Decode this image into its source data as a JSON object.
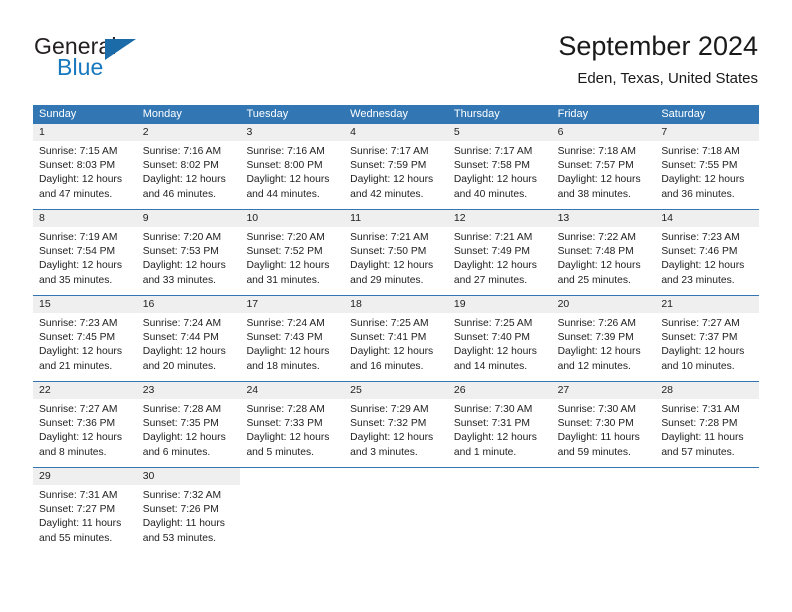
{
  "brand": {
    "name_part1": "General",
    "name_part2": "Blue",
    "triangle_icon": "brand-triangle-icon",
    "accent_color": "#1878be",
    "triangle_color": "#1a6ba8"
  },
  "header": {
    "title": "September 2024",
    "subtitle": "Eden, Texas, United States"
  },
  "theme": {
    "header_blue": "#3277b4",
    "day_number_bg": "#efefef",
    "text_color": "#222222"
  },
  "weekdays": [
    "Sunday",
    "Monday",
    "Tuesday",
    "Wednesday",
    "Thursday",
    "Friday",
    "Saturday"
  ],
  "weeks": [
    [
      {
        "day": "1",
        "sunrise": "Sunrise: 7:15 AM",
        "sunset": "Sunset: 8:03 PM",
        "daylight1": "Daylight: 12 hours",
        "daylight2": "and 47 minutes."
      },
      {
        "day": "2",
        "sunrise": "Sunrise: 7:16 AM",
        "sunset": "Sunset: 8:02 PM",
        "daylight1": "Daylight: 12 hours",
        "daylight2": "and 46 minutes."
      },
      {
        "day": "3",
        "sunrise": "Sunrise: 7:16 AM",
        "sunset": "Sunset: 8:00 PM",
        "daylight1": "Daylight: 12 hours",
        "daylight2": "and 44 minutes."
      },
      {
        "day": "4",
        "sunrise": "Sunrise: 7:17 AM",
        "sunset": "Sunset: 7:59 PM",
        "daylight1": "Daylight: 12 hours",
        "daylight2": "and 42 minutes."
      },
      {
        "day": "5",
        "sunrise": "Sunrise: 7:17 AM",
        "sunset": "Sunset: 7:58 PM",
        "daylight1": "Daylight: 12 hours",
        "daylight2": "and 40 minutes."
      },
      {
        "day": "6",
        "sunrise": "Sunrise: 7:18 AM",
        "sunset": "Sunset: 7:57 PM",
        "daylight1": "Daylight: 12 hours",
        "daylight2": "and 38 minutes."
      },
      {
        "day": "7",
        "sunrise": "Sunrise: 7:18 AM",
        "sunset": "Sunset: 7:55 PM",
        "daylight1": "Daylight: 12 hours",
        "daylight2": "and 36 minutes."
      }
    ],
    [
      {
        "day": "8",
        "sunrise": "Sunrise: 7:19 AM",
        "sunset": "Sunset: 7:54 PM",
        "daylight1": "Daylight: 12 hours",
        "daylight2": "and 35 minutes."
      },
      {
        "day": "9",
        "sunrise": "Sunrise: 7:20 AM",
        "sunset": "Sunset: 7:53 PM",
        "daylight1": "Daylight: 12 hours",
        "daylight2": "and 33 minutes."
      },
      {
        "day": "10",
        "sunrise": "Sunrise: 7:20 AM",
        "sunset": "Sunset: 7:52 PM",
        "daylight1": "Daylight: 12 hours",
        "daylight2": "and 31 minutes."
      },
      {
        "day": "11",
        "sunrise": "Sunrise: 7:21 AM",
        "sunset": "Sunset: 7:50 PM",
        "daylight1": "Daylight: 12 hours",
        "daylight2": "and 29 minutes."
      },
      {
        "day": "12",
        "sunrise": "Sunrise: 7:21 AM",
        "sunset": "Sunset: 7:49 PM",
        "daylight1": "Daylight: 12 hours",
        "daylight2": "and 27 minutes."
      },
      {
        "day": "13",
        "sunrise": "Sunrise: 7:22 AM",
        "sunset": "Sunset: 7:48 PM",
        "daylight1": "Daylight: 12 hours",
        "daylight2": "and 25 minutes."
      },
      {
        "day": "14",
        "sunrise": "Sunrise: 7:23 AM",
        "sunset": "Sunset: 7:46 PM",
        "daylight1": "Daylight: 12 hours",
        "daylight2": "and 23 minutes."
      }
    ],
    [
      {
        "day": "15",
        "sunrise": "Sunrise: 7:23 AM",
        "sunset": "Sunset: 7:45 PM",
        "daylight1": "Daylight: 12 hours",
        "daylight2": "and 21 minutes."
      },
      {
        "day": "16",
        "sunrise": "Sunrise: 7:24 AM",
        "sunset": "Sunset: 7:44 PM",
        "daylight1": "Daylight: 12 hours",
        "daylight2": "and 20 minutes."
      },
      {
        "day": "17",
        "sunrise": "Sunrise: 7:24 AM",
        "sunset": "Sunset: 7:43 PM",
        "daylight1": "Daylight: 12 hours",
        "daylight2": "and 18 minutes."
      },
      {
        "day": "18",
        "sunrise": "Sunrise: 7:25 AM",
        "sunset": "Sunset: 7:41 PM",
        "daylight1": "Daylight: 12 hours",
        "daylight2": "and 16 minutes."
      },
      {
        "day": "19",
        "sunrise": "Sunrise: 7:25 AM",
        "sunset": "Sunset: 7:40 PM",
        "daylight1": "Daylight: 12 hours",
        "daylight2": "and 14 minutes."
      },
      {
        "day": "20",
        "sunrise": "Sunrise: 7:26 AM",
        "sunset": "Sunset: 7:39 PM",
        "daylight1": "Daylight: 12 hours",
        "daylight2": "and 12 minutes."
      },
      {
        "day": "21",
        "sunrise": "Sunrise: 7:27 AM",
        "sunset": "Sunset: 7:37 PM",
        "daylight1": "Daylight: 12 hours",
        "daylight2": "and 10 minutes."
      }
    ],
    [
      {
        "day": "22",
        "sunrise": "Sunrise: 7:27 AM",
        "sunset": "Sunset: 7:36 PM",
        "daylight1": "Daylight: 12 hours",
        "daylight2": "and 8 minutes."
      },
      {
        "day": "23",
        "sunrise": "Sunrise: 7:28 AM",
        "sunset": "Sunset: 7:35 PM",
        "daylight1": "Daylight: 12 hours",
        "daylight2": "and 6 minutes."
      },
      {
        "day": "24",
        "sunrise": "Sunrise: 7:28 AM",
        "sunset": "Sunset: 7:33 PM",
        "daylight1": "Daylight: 12 hours",
        "daylight2": "and 5 minutes."
      },
      {
        "day": "25",
        "sunrise": "Sunrise: 7:29 AM",
        "sunset": "Sunset: 7:32 PM",
        "daylight1": "Daylight: 12 hours",
        "daylight2": "and 3 minutes."
      },
      {
        "day": "26",
        "sunrise": "Sunrise: 7:30 AM",
        "sunset": "Sunset: 7:31 PM",
        "daylight1": "Daylight: 12 hours",
        "daylight2": "and 1 minute."
      },
      {
        "day": "27",
        "sunrise": "Sunrise: 7:30 AM",
        "sunset": "Sunset: 7:30 PM",
        "daylight1": "Daylight: 11 hours",
        "daylight2": "and 59 minutes."
      },
      {
        "day": "28",
        "sunrise": "Sunrise: 7:31 AM",
        "sunset": "Sunset: 7:28 PM",
        "daylight1": "Daylight: 11 hours",
        "daylight2": "and 57 minutes."
      }
    ],
    [
      {
        "day": "29",
        "sunrise": "Sunrise: 7:31 AM",
        "sunset": "Sunset: 7:27 PM",
        "daylight1": "Daylight: 11 hours",
        "daylight2": "and 55 minutes."
      },
      {
        "day": "30",
        "sunrise": "Sunrise: 7:32 AM",
        "sunset": "Sunset: 7:26 PM",
        "daylight1": "Daylight: 11 hours",
        "daylight2": "and 53 minutes."
      },
      {
        "day": "",
        "sunrise": "",
        "sunset": "",
        "daylight1": "",
        "daylight2": ""
      },
      {
        "day": "",
        "sunrise": "",
        "sunset": "",
        "daylight1": "",
        "daylight2": ""
      },
      {
        "day": "",
        "sunrise": "",
        "sunset": "",
        "daylight1": "",
        "daylight2": ""
      },
      {
        "day": "",
        "sunrise": "",
        "sunset": "",
        "daylight1": "",
        "daylight2": ""
      },
      {
        "day": "",
        "sunrise": "",
        "sunset": "",
        "daylight1": "",
        "daylight2": ""
      }
    ]
  ]
}
